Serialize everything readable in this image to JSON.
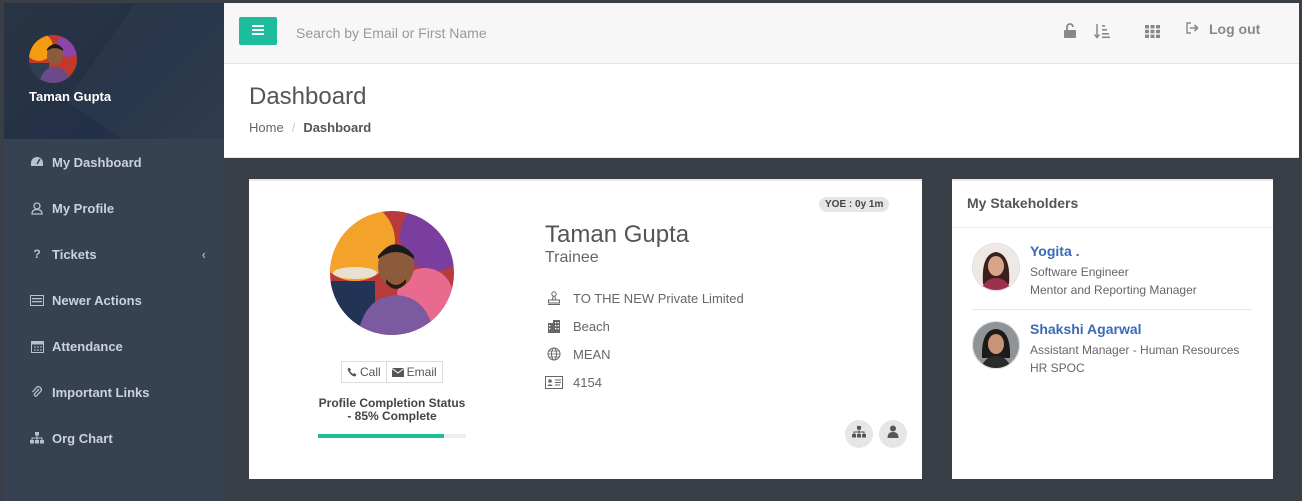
{
  "sidebar": {
    "user_name": "Taman Gupta",
    "items": [
      {
        "label": "My Dashboard",
        "icon": "dashboard-icon"
      },
      {
        "label": "My Profile",
        "icon": "user-icon"
      },
      {
        "label": "Tickets",
        "icon": "question-icon",
        "chevron": "‹"
      },
      {
        "label": "Newer Actions",
        "icon": "list-icon"
      },
      {
        "label": "Attendance",
        "icon": "calendar-icon"
      },
      {
        "label": "Important Links",
        "icon": "paperclip-icon"
      },
      {
        "label": "Org Chart",
        "icon": "sitemap-icon"
      }
    ]
  },
  "topbar": {
    "search_placeholder": "Search by Email or First Name",
    "logout_label": "Log out",
    "accent": "#1cbc9c"
  },
  "header": {
    "title": "Dashboard",
    "breadcrumb": {
      "home": "Home",
      "separator": "/",
      "current": "Dashboard"
    }
  },
  "profile": {
    "yoe_badge": "YOE : 0y 1m",
    "name": "Taman Gupta",
    "role": "Trainee",
    "company": "TO THE NEW Private Limited",
    "location": "Beach",
    "stack": "MEAN",
    "employee_id": "4154",
    "call_label": "Call",
    "email_label": "Email",
    "completion_line1": "Profile Completion Status",
    "completion_line2": "- 85% Complete",
    "completion_fraction": 0.85
  },
  "stakeholders": {
    "title": "My Stakeholders",
    "people": [
      {
        "name": "Yogita .",
        "designation": "Software Engineer",
        "relation": "Mentor and Reporting Manager"
      },
      {
        "name": "Shakshi Agarwal",
        "designation": "Assistant Manager - Human Resources",
        "relation": "HR SPOC"
      }
    ]
  }
}
